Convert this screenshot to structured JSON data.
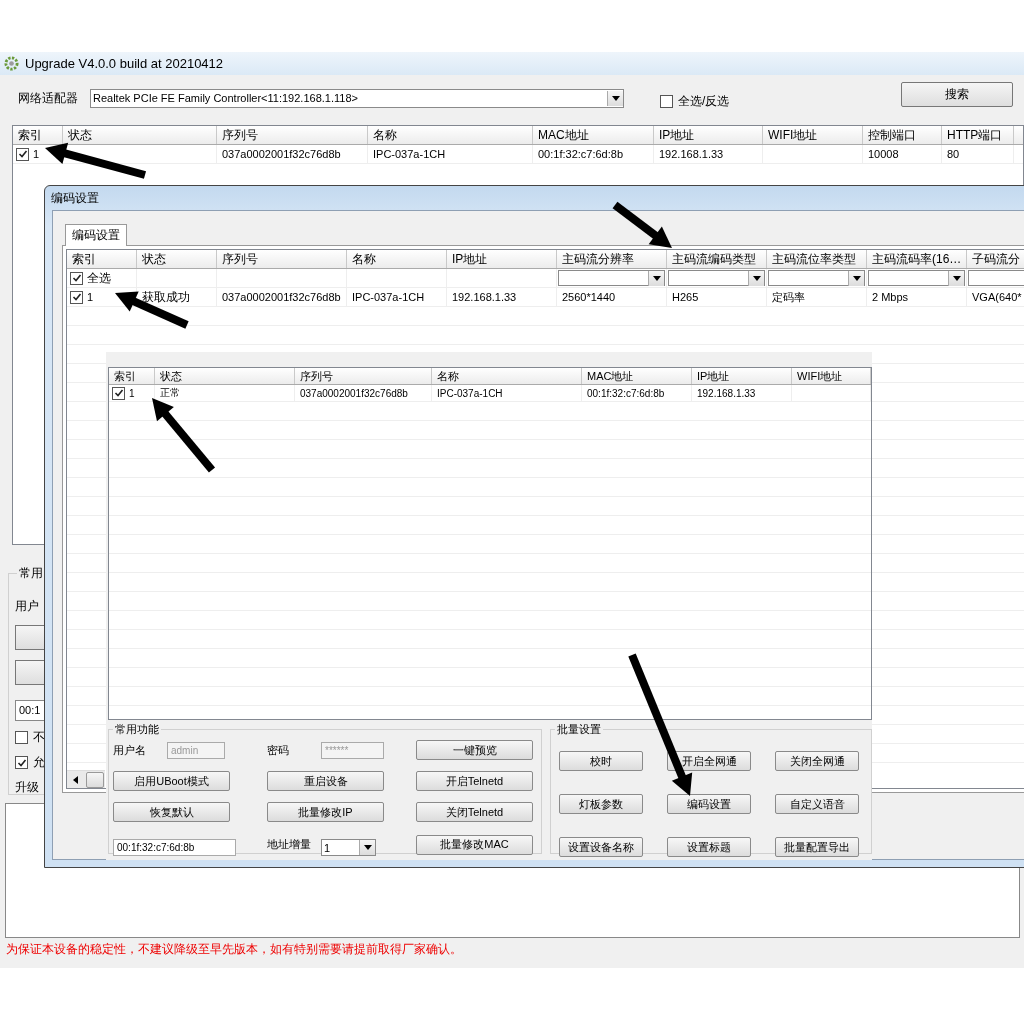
{
  "window": {
    "title": "Upgrade V4.0.0 build at 20210412"
  },
  "adapter": {
    "label": "网络适配器",
    "value": "Realtek PCIe FE Family Controller<11:192.168.1.118>"
  },
  "select_all": {
    "label": "全选/反选",
    "checked": false
  },
  "search_button": "搜索",
  "device_table": {
    "columns": [
      "索引",
      "状态",
      "序列号",
      "名称",
      "MAC地址",
      "IP地址",
      "WIFI地址",
      "控制端口",
      "HTTP端口"
    ],
    "rows": [
      {
        "checked": true,
        "cells": [
          "1",
          "",
          "037a0002001f32c76d8b",
          "IPC-037a-1CH",
          "00:1f:32:c7:6d:8b",
          "192.168.1.33",
          "",
          "10008",
          "80"
        ]
      }
    ]
  },
  "common_panel": {
    "title": "常用",
    "username_label": "用户",
    "mac_field": "00:1",
    "options": [
      {
        "label": "不",
        "checked": false
      },
      {
        "label": "允",
        "checked": true
      }
    ],
    "upgrade_label": "升级"
  },
  "log": {
    "notice": "为保证本设备的稳定性，不建议降级至早先版本，如有特别需要请提前取得厂家确认。"
  },
  "encode_dialog": {
    "title": "编码设置",
    "tabs": [
      {
        "label": "编码设置",
        "selected": true
      }
    ],
    "columns": [
      "索引",
      "状态",
      "序列号",
      "名称",
      "IP地址",
      "主码流分辨率",
      "主码流编码类型",
      "主码流位率类型",
      "主码流码率(16…",
      "子码流分"
    ],
    "select_all": {
      "label": "全选",
      "checked": true
    },
    "rows": [
      {
        "checked": true,
        "cells": [
          "1",
          "获取成功",
          "037a0002001f32c76d8b",
          "IPC-037a-1CH",
          "192.168.1.33",
          "2560*1440",
          "H265",
          "定码率",
          "2 Mbps",
          "VGA(640*"
        ]
      }
    ]
  },
  "embedded_screenshot": {
    "columns": [
      "索引",
      "状态",
      "序列号",
      "名称",
      "MAC地址",
      "IP地址",
      "WIFI地址"
    ],
    "rows": [
      {
        "checked": true,
        "cells": [
          "1",
          "正常",
          "037a0002001f32c76d8b",
          "IPC-037a-1CH",
          "00:1f:32:c7:6d:8b",
          "192.168.1.33",
          ""
        ]
      }
    ],
    "common": {
      "title": "常用功能",
      "username_label": "用户名",
      "username": "admin",
      "password_label": "密码",
      "password": "******",
      "increment_label": "地址增量",
      "increment": "1",
      "mac": "00:1f:32:c7:6d:8b",
      "buttons": [
        "一键预览",
        "启用UBoot模式",
        "重启设备",
        "开启Telnetd",
        "恢复默认",
        "批量修改IP",
        "关闭Telnetd",
        "批量修改MAC"
      ]
    },
    "batch": {
      "title": "批量设置",
      "buttons": [
        "校时",
        "开启全网通",
        "关闭全网通",
        "灯板参数",
        "编码设置",
        "自定义语音",
        "设置设备名称",
        "设置标题",
        "批量配置导出"
      ]
    }
  }
}
